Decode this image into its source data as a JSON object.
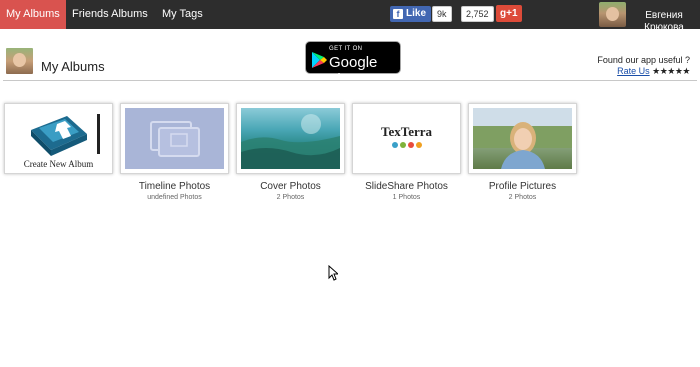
{
  "topbar": {
    "tabs": [
      {
        "label": "My Albums",
        "active": true
      },
      {
        "label": "Friends Albums",
        "active": false
      },
      {
        "label": "My Tags",
        "active": false
      }
    ],
    "fb_like_label": "Like",
    "fb_like_count": "9k",
    "share_count": "2,752",
    "gplus_label": "+1",
    "gplus_g": "g",
    "user_name": "Евгения Крюкова"
  },
  "header": {
    "title": "My Albums",
    "gplay_small": "GET IT ON",
    "gplay_big": "Google play",
    "found_text": "Found our app useful ?",
    "rate_link": "Rate Us",
    "stars": "★★★★★"
  },
  "albums": [
    {
      "label": "",
      "count": "",
      "thumb_text": "Create New Album",
      "icon": "create-album-icon"
    },
    {
      "label": "Timeline Photos",
      "count": "undefined Photos",
      "icon": "photos-stack-icon"
    },
    {
      "label": "Cover Photos",
      "count": "2 Photos"
    },
    {
      "label": "SlideShare Photos",
      "count": "1 Photos",
      "logo_text": "TexTerra"
    },
    {
      "label": "Profile Pictures",
      "count": "2 Photos"
    }
  ],
  "colors": {
    "topbar_bg": "#2d2d2d",
    "active_tab": "#d9534f",
    "facebook": "#4267b2",
    "gplus": "#dd4b39",
    "link": "#1a4ea8"
  }
}
